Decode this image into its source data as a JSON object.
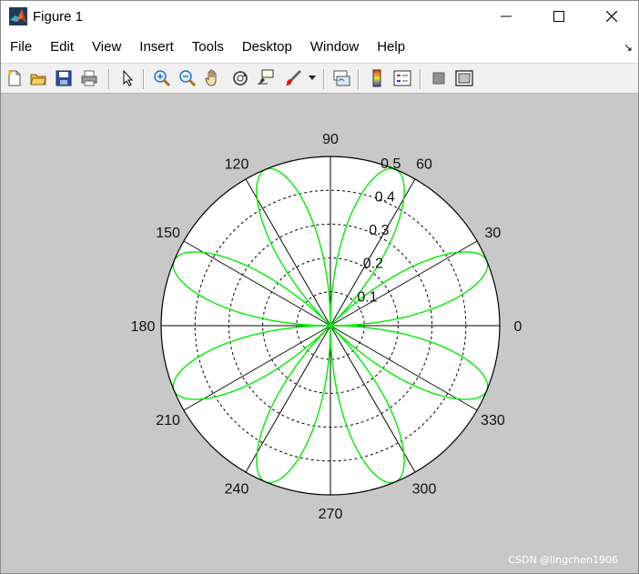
{
  "window": {
    "title": "Figure 1",
    "controls": [
      "minimize",
      "maximize",
      "close"
    ]
  },
  "menu": [
    "File",
    "Edit",
    "View",
    "Insert",
    "Tools",
    "Desktop",
    "Window",
    "Help"
  ],
  "menu_dock_glyph": "↘",
  "toolbar": {
    "icons": [
      "new-figure-icon",
      "open-file-icon",
      "save-icon",
      "print-icon",
      "edit-plot-arrow-icon",
      "zoom-in-icon",
      "zoom-out-icon",
      "pan-hand-icon",
      "rotate-3d-icon",
      "data-cursor-icon",
      "brush-icon",
      "brush-dropdown-icon",
      "link-plot-icon",
      "insert-colorbar-icon",
      "insert-legend-icon",
      "hide-plot-tools-icon",
      "show-plot-tools-icon"
    ]
  },
  "chart_data": {
    "type": "polar-line",
    "equation_shape": "rose curve r = 0.5·|sin(2θ)·cos(2θ)| style, 8 petals",
    "rmax": 0.5,
    "r_ticks": [
      0.1,
      0.2,
      0.3,
      0.4,
      0.5
    ],
    "r_tick_labels": [
      "0.1",
      "0.2",
      "0.3",
      "0.4",
      "0.5"
    ],
    "theta_ticks_deg": [
      0,
      30,
      60,
      90,
      120,
      150,
      180,
      210,
      240,
      270,
      300,
      330
    ],
    "theta_tick_labels": [
      "0",
      "30",
      "60",
      "90",
      "120",
      "150",
      "180",
      "210",
      "240",
      "270",
      "300",
      "330"
    ],
    "series": [
      {
        "color": "#00ee00",
        "petal_count": 8,
        "petal_peak_angles_deg": [
          22.5,
          67.5,
          112.5,
          157.5,
          202.5,
          247.5,
          292.5,
          337.5
        ],
        "petal_peak_r": 0.5
      }
    ],
    "grid": true,
    "grid_style": "dashed"
  },
  "watermark": "CSDN @lingchen1906"
}
